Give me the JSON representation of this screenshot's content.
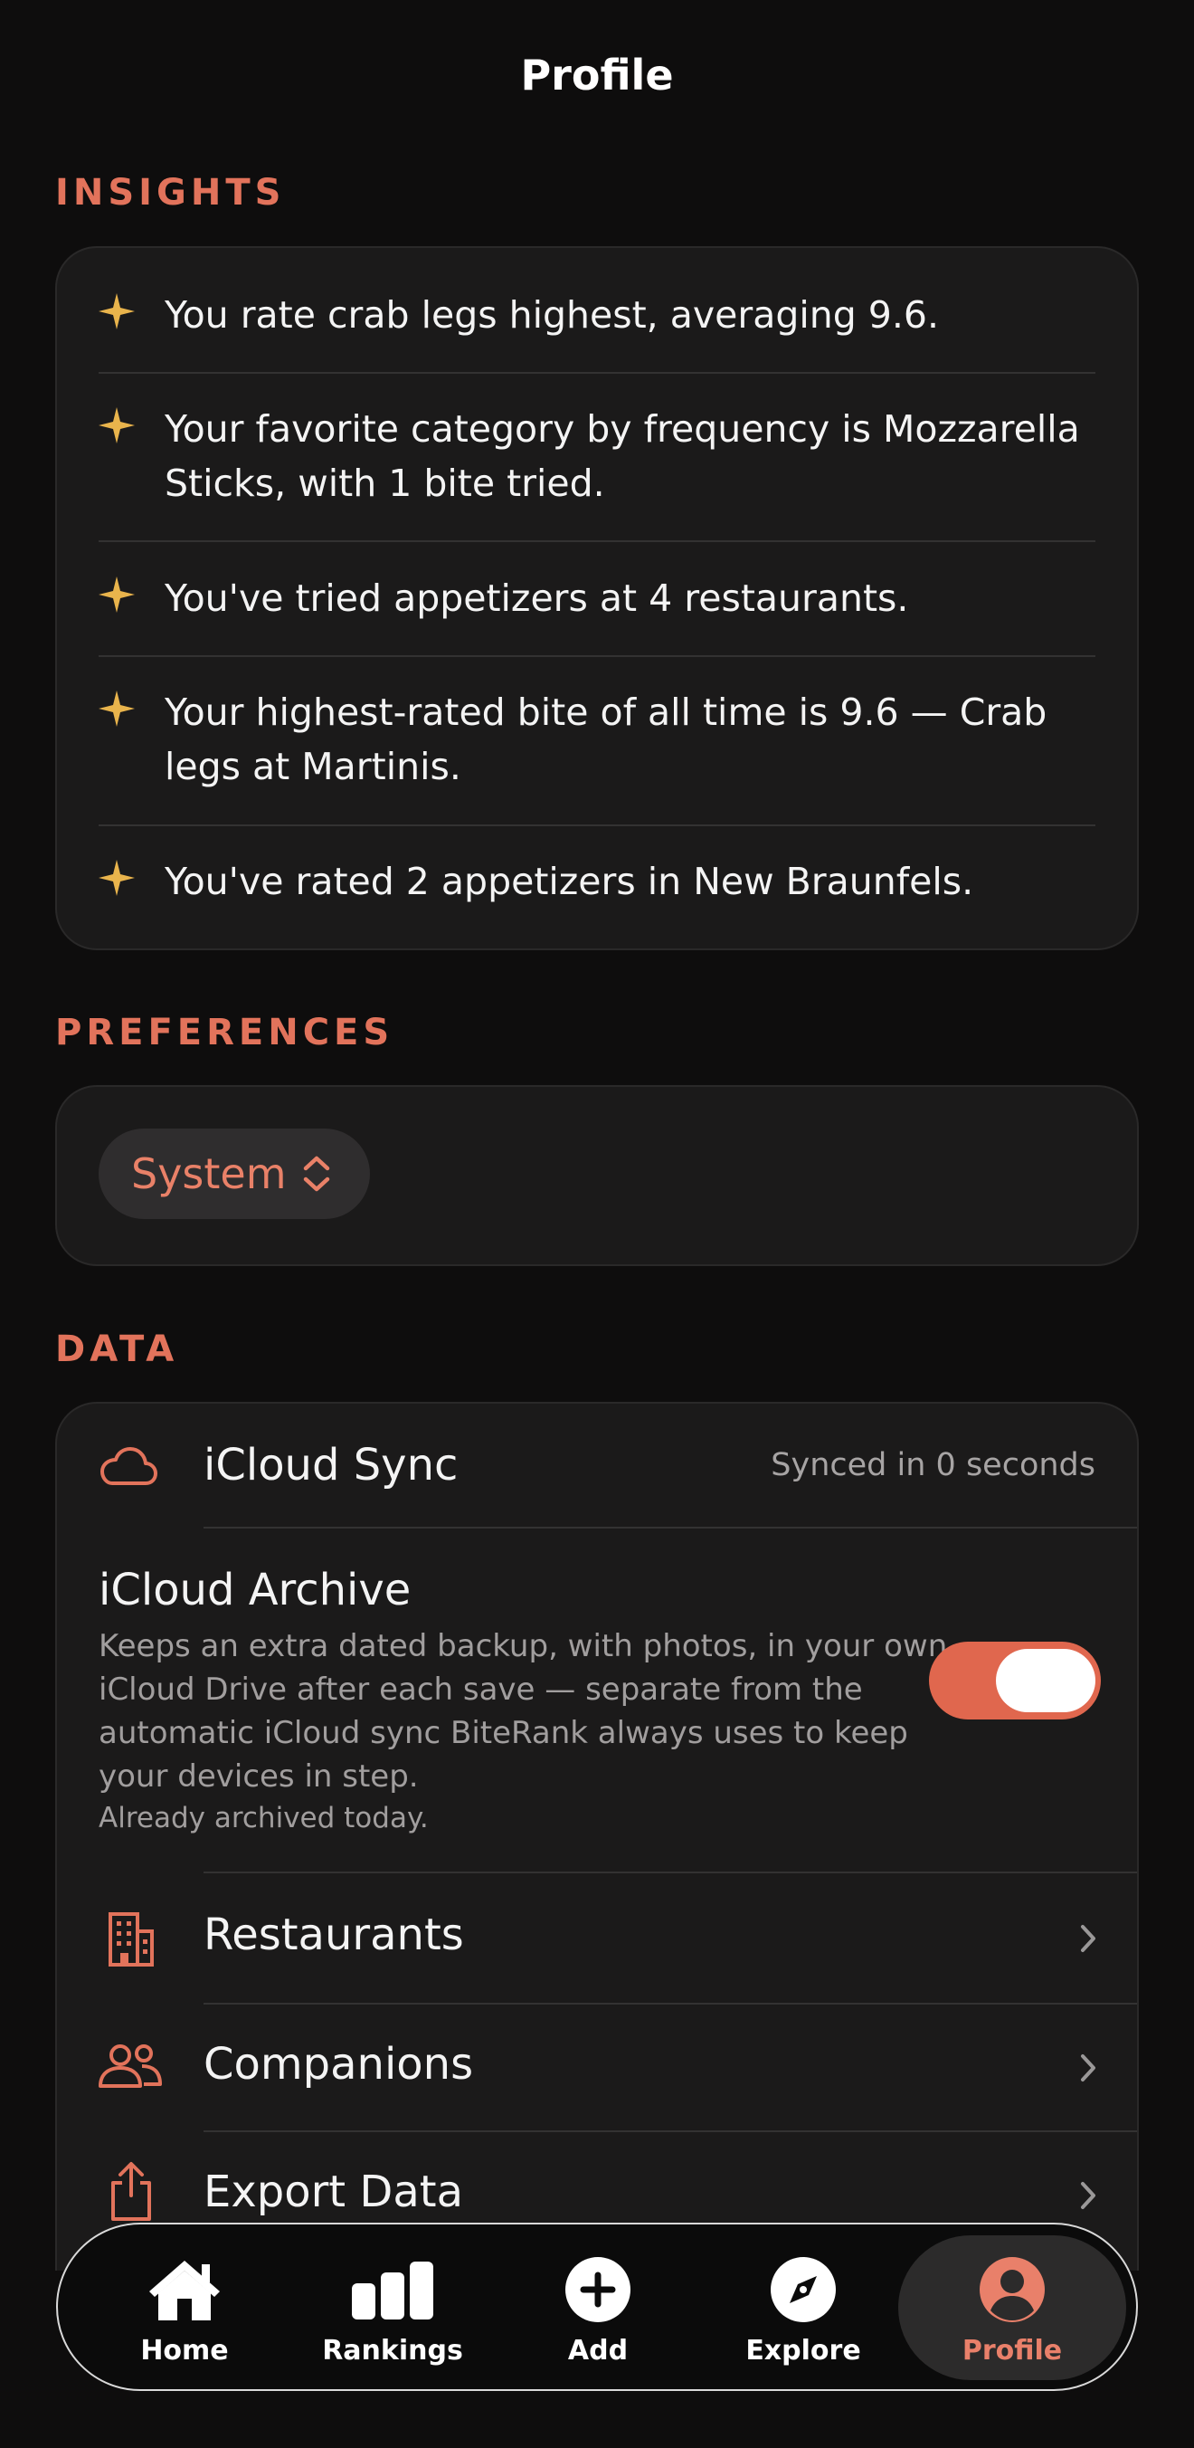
{
  "header": {
    "title": "Profile"
  },
  "insights": {
    "heading": "INSIGHTS",
    "items": [
      "You rate crab legs highest, averaging 9.6.",
      "Your favorite category by frequency is Mozzarella Sticks, with 1 bite tried.",
      "You've tried appetizers at 4 restaurants.",
      "Your highest-rated bite of all time is 9.6 — Crab legs at Martinis.",
      "You've rated 2 appetizers in New Braunfels."
    ],
    "icon": "sparkle-icon",
    "accent": "#e9b44c"
  },
  "preferences": {
    "heading": "PREFERENCES",
    "appearance_value": "System",
    "icon": "chevron-up-down-icon"
  },
  "data": {
    "heading": "DATA",
    "icloud_sync": {
      "label": "iCloud Sync",
      "status": "Synced in 0 seconds",
      "icon": "cloud-icon"
    },
    "icloud_archive": {
      "label": "iCloud Archive",
      "description": "Keeps an extra dated backup, with photos, in your own iCloud Drive after each save — separate from the automatic iCloud sync BiteRank always uses to keep your devices in step.",
      "note": "Already archived today.",
      "enabled": true
    },
    "rows": [
      {
        "label": "Restaurants",
        "icon": "building-icon"
      },
      {
        "label": "Companions",
        "icon": "people-icon"
      },
      {
        "label": "Export Data",
        "icon": "share-icon"
      }
    ]
  },
  "tabbar": {
    "tabs": [
      {
        "label": "Home",
        "icon": "house-icon"
      },
      {
        "label": "Rankings",
        "icon": "bar-chart-icon"
      },
      {
        "label": "Add",
        "icon": "plus-circle-icon"
      },
      {
        "label": "Explore",
        "icon": "compass-icon"
      },
      {
        "label": "Profile",
        "icon": "person-circle-icon"
      }
    ],
    "active": "Profile"
  },
  "colors": {
    "accent": "#e2735b",
    "background": "#0e0d0d",
    "card": "#1b1a1a",
    "toggle_on": "#e0674e"
  }
}
